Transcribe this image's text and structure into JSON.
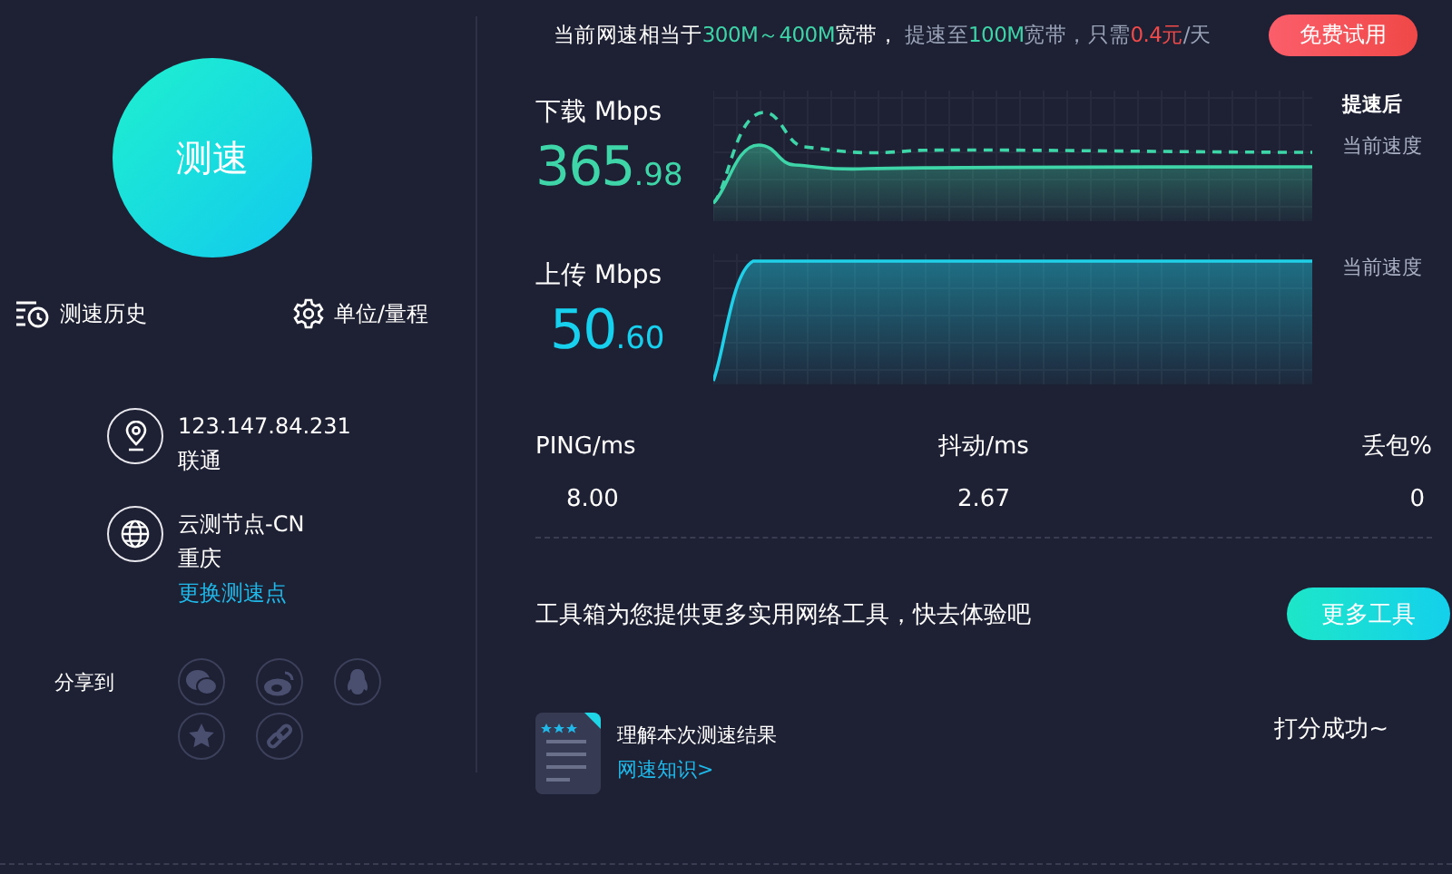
{
  "banner": {
    "segments": [
      {
        "text": "当前网速相当于",
        "color": "#ffffff"
      },
      {
        "text": "300M～400M",
        "color": "#3ed5a8"
      },
      {
        "text": "宽带，",
        "color": "#ffffff"
      },
      {
        "text": " 提速至",
        "color": "#9aa3b8"
      },
      {
        "text": "100M",
        "color": "#3ed5a8"
      },
      {
        "text": "宽带，只需",
        "color": "#9aa3b8"
      },
      {
        "text": "0.4元",
        "color": "#f04a4a"
      },
      {
        "text": "/天",
        "color": "#9aa3b8"
      }
    ],
    "button": "免费试用"
  },
  "sidebar": {
    "start_button": "测速",
    "actions": [
      {
        "label": "测速历史",
        "kind": "history"
      },
      {
        "label": "单位/量程",
        "kind": "settings"
      }
    ],
    "ip": {
      "address": "123.147.84.231",
      "isp": "联通"
    },
    "node": {
      "name": "云测节点-CN",
      "city": "重庆",
      "change_link": "更换测速点"
    },
    "share": {
      "label": "分享到"
    }
  },
  "charts": [
    {
      "kind": "download",
      "label": "下载 Mbps",
      "whole": "365",
      "fraction": ".98",
      "legends": [
        "提速后",
        "当前速度"
      ]
    },
    {
      "kind": "upload",
      "label": "上传 Mbps",
      "whole": "50",
      "fraction": ".60",
      "legends": [
        "当前速度"
      ]
    }
  ],
  "stats": [
    {
      "label": "PING/ms",
      "value": "8.00"
    },
    {
      "label": "抖动/ms",
      "value": "2.67"
    },
    {
      "label": "丢包%",
      "value": "0"
    }
  ],
  "tools": {
    "text": "工具箱为您提供更多实用网络工具，快去体验吧",
    "button": "更多工具"
  },
  "knowledge": {
    "title": "理解本次测速结果",
    "link": "网速知识>"
  },
  "rating": {
    "status": "打分成功~"
  }
}
